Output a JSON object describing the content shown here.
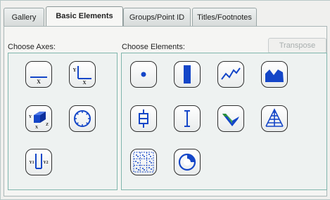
{
  "tabs": [
    {
      "label": "Gallery"
    },
    {
      "label": "Basic Elements"
    },
    {
      "label": "Groups/Point ID"
    },
    {
      "label": "Titles/Footnotes"
    }
  ],
  "transpose_label": "Transpose",
  "axes_section": {
    "label": "Choose Axes:"
  },
  "elements_section": {
    "label": "Choose Elements:"
  },
  "axis_icon_text": {
    "x": "X",
    "y": "Y",
    "z": "Z",
    "y1": "Y1",
    "y2": "Y2"
  },
  "colors": {
    "accent_blue": "#1446c8",
    "group_border": "#7fb5ac",
    "active_tab_bg": "#f7f7f5"
  }
}
